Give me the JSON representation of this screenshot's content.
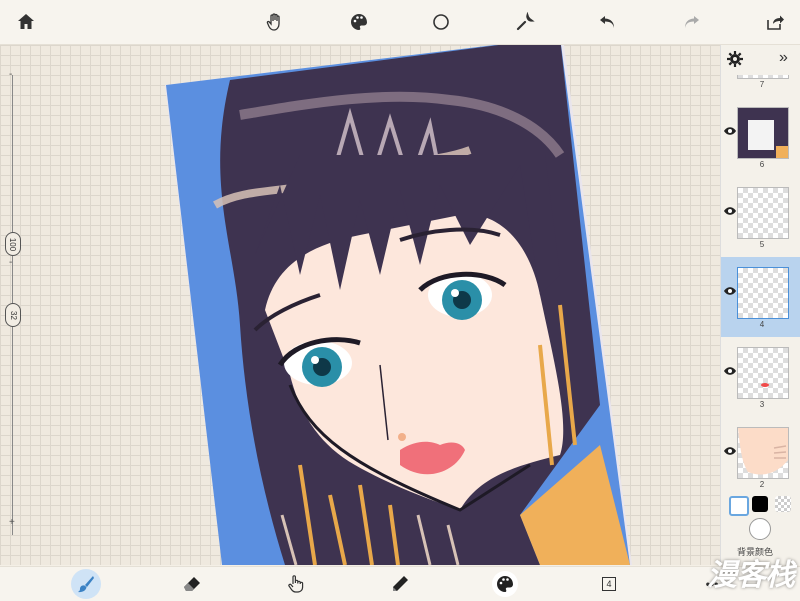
{
  "toolbar": {
    "icons": [
      "home-icon",
      "hand-icon",
      "palette-icon",
      "circle-icon",
      "wrench-icon",
      "undo-icon",
      "redo-icon",
      "share-icon"
    ]
  },
  "left_rail": {
    "brush_size": "100",
    "opacity": "32",
    "plus": "+",
    "minus": "-"
  },
  "layers": {
    "items": [
      {
        "number": "7",
        "visible": true,
        "selected": false
      },
      {
        "number": "6",
        "visible": true,
        "selected": false
      },
      {
        "number": "5",
        "visible": true,
        "selected": false
      },
      {
        "number": "4",
        "visible": true,
        "selected": true
      },
      {
        "number": "3",
        "visible": true,
        "selected": false
      },
      {
        "number": "2",
        "visible": true,
        "selected": false
      }
    ]
  },
  "colors": {
    "primary": "#ffffff",
    "secondary": "#000000",
    "background_label": "背景颜色"
  },
  "bottom_toolbar": {
    "layer_count": "4",
    "more": "•••"
  },
  "watermark": "漫客栈",
  "palette": {
    "blue_bg": "#5b8fe0",
    "hair": "#3e3350",
    "skin": "#fde7dc",
    "eyes": "#2a8fa8",
    "lips": "#f0707a",
    "shirt": "#f0b05a"
  }
}
